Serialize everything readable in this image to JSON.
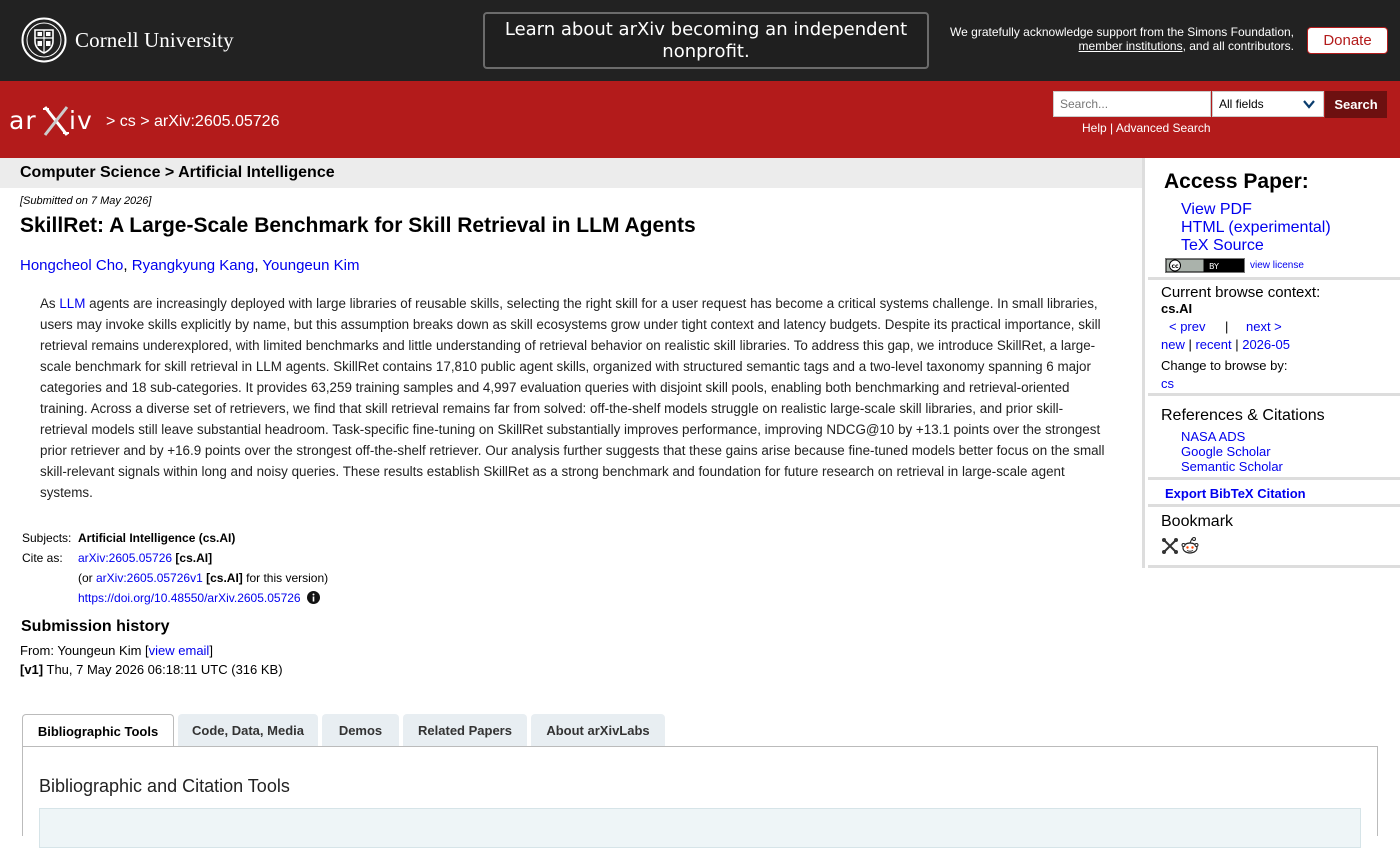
{
  "topbar": {
    "university": "Cornell University",
    "banner": "Learn about arXiv becoming an independent nonprofit.",
    "support_text": "We gratefully acknowledge support from the Simons Foundation,",
    "support_link": "member institutions",
    "support_tail": ", and all contributors.",
    "donate": "Donate"
  },
  "header": {
    "logo_alt": "arXiv",
    "crumb_sep1": " > ",
    "crumb_cs": "cs",
    "crumb_sep2": " > ",
    "crumb_id": "arXiv:2605.05726",
    "search_placeholder": "Search...",
    "field_select": "All fields",
    "search_button": "Search",
    "help": "Help",
    "help_sep": " | ",
    "advanced": "Advanced Search"
  },
  "subheader": "Computer Science > Artificial Intelligence",
  "paper": {
    "submitted": "[Submitted on 7 May 2026]",
    "title": "SkillRet: A Large-Scale Benchmark for Skill Retrieval in LLM Agents",
    "authors": [
      "Hongcheol Cho",
      "Ryangkyung Kang",
      "Youngeun Kim"
    ],
    "abstract_pre": "As ",
    "abstract_kw": "LLM",
    "abstract_post": " agents are increasingly deployed with large libraries of reusable skills, selecting the right skill for a user request has become a critical systems challenge. In small libraries, users may invoke skills explicitly by name, but this assumption breaks down as skill ecosystems grow under tight context and latency budgets. Despite its practical importance, skill retrieval remains underexplored, with limited benchmarks and little understanding of retrieval behavior on realistic skill libraries. To address this gap, we introduce SkillRet, a large-scale benchmark for skill retrieval in LLM agents. SkillRet contains 17,810 public agent skills, organized with structured semantic tags and a two-level taxonomy spanning 6 major categories and 18 sub-categories. It provides 63,259 training samples and 4,997 evaluation queries with disjoint skill pools, enabling both benchmarking and retrieval-oriented training. Across a diverse set of retrievers, we find that skill retrieval remains far from solved: off-the-shelf models struggle on realistic large-scale skill libraries, and prior skill-retrieval models still leave substantial headroom. Task-specific fine-tuning on SkillRet substantially improves performance, improving NDCG@10 by +13.1 points over the strongest prior retriever and by +16.9 points over the strongest off-the-shelf retriever. Our analysis further suggests that these gains arise because fine-tuned models better focus on the small skill-relevant signals within long and noisy queries. These results establish SkillRet as a strong benchmark and foundation for future research on retrieval in large-scale agent systems."
  },
  "meta": {
    "subjects_label": "Subjects:",
    "subjects_value": "Artificial Intelligence (cs.AI)",
    "cite_label": "Cite as:",
    "cite_id": "arXiv:2605.05726",
    "cite_cat": "[cs.AI]",
    "or_pre": "(or ",
    "or_id": "arXiv:2605.05726v1",
    "or_cat": "[cs.AI]",
    "or_post": " for this version)",
    "doi": "https://doi.org/10.48550/arXiv.2605.05726"
  },
  "history": {
    "title": "Submission history",
    "from_pre": "From: Youngeun Kim [",
    "view_email": "view email",
    "from_post": "]",
    "v1_label": "[v1]",
    "v1_text": " Thu, 7 May 2026 06:18:11 UTC (316 KB)"
  },
  "tabs": [
    {
      "label": "Bibliographic Tools",
      "active": true
    },
    {
      "label": "Code, Data, Media",
      "active": false
    },
    {
      "label": "Demos",
      "active": false
    },
    {
      "label": "Related Papers",
      "active": false
    },
    {
      "label": "About arXivLabs",
      "active": false
    }
  ],
  "panel_title": "Bibliographic and Citation Tools",
  "sidebar": {
    "access_title": "Access Paper:",
    "access_links": [
      "View PDF",
      "HTML (experimental)",
      "TeX Source"
    ],
    "cc_badge": "(cc) BY",
    "view_license": "view license",
    "browse_title": "Current browse context:",
    "browse_cat": "cs.AI",
    "prev": "< prev",
    "nav_sep": "|",
    "next": "next >",
    "new": "new",
    "recent": "recent",
    "month": "2026-05",
    "date_sep": " | ",
    "change_browse": "Change to browse by:",
    "cs": "cs",
    "refs_title": "References & Citations",
    "refs_links": [
      "NASA ADS",
      "Google Scholar",
      "Semantic Scholar"
    ],
    "export": "Export BibTeX Citation",
    "bookmark_title": "Bookmark"
  },
  "colors": {
    "arxiv_red": "#b31b1b",
    "topbar": "#222222",
    "link": "#0000ee"
  }
}
